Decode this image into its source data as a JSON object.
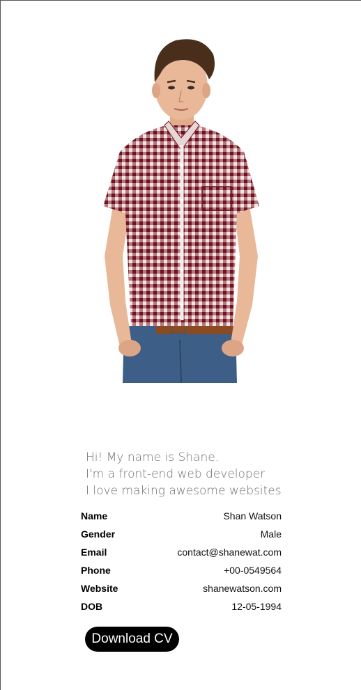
{
  "intro": {
    "line1": "Hi! My name is Shane.",
    "line2": "I'm a front-end web developer",
    "line3": "I love making awesome websites"
  },
  "info": [
    {
      "label": "Name",
      "value": "Shan Watson"
    },
    {
      "label": "Gender",
      "value": "Male"
    },
    {
      "label": "Email",
      "value": "contact@shanewat.com"
    },
    {
      "label": "Phone",
      "value": "+00-0549564"
    },
    {
      "label": "Website",
      "value": "shanewatson.com"
    },
    {
      "label": "DOB",
      "value": "12-05-1994"
    }
  ],
  "download_label": "Download CV",
  "colors": {
    "shirt": "#7a1e2a",
    "jeans": "#3b5f8a",
    "belt": "#8a4a22",
    "skin": "#e8b898",
    "hair": "#4a2e1c",
    "button_bg": "#000000",
    "intro_text": "#6e6e6e"
  }
}
